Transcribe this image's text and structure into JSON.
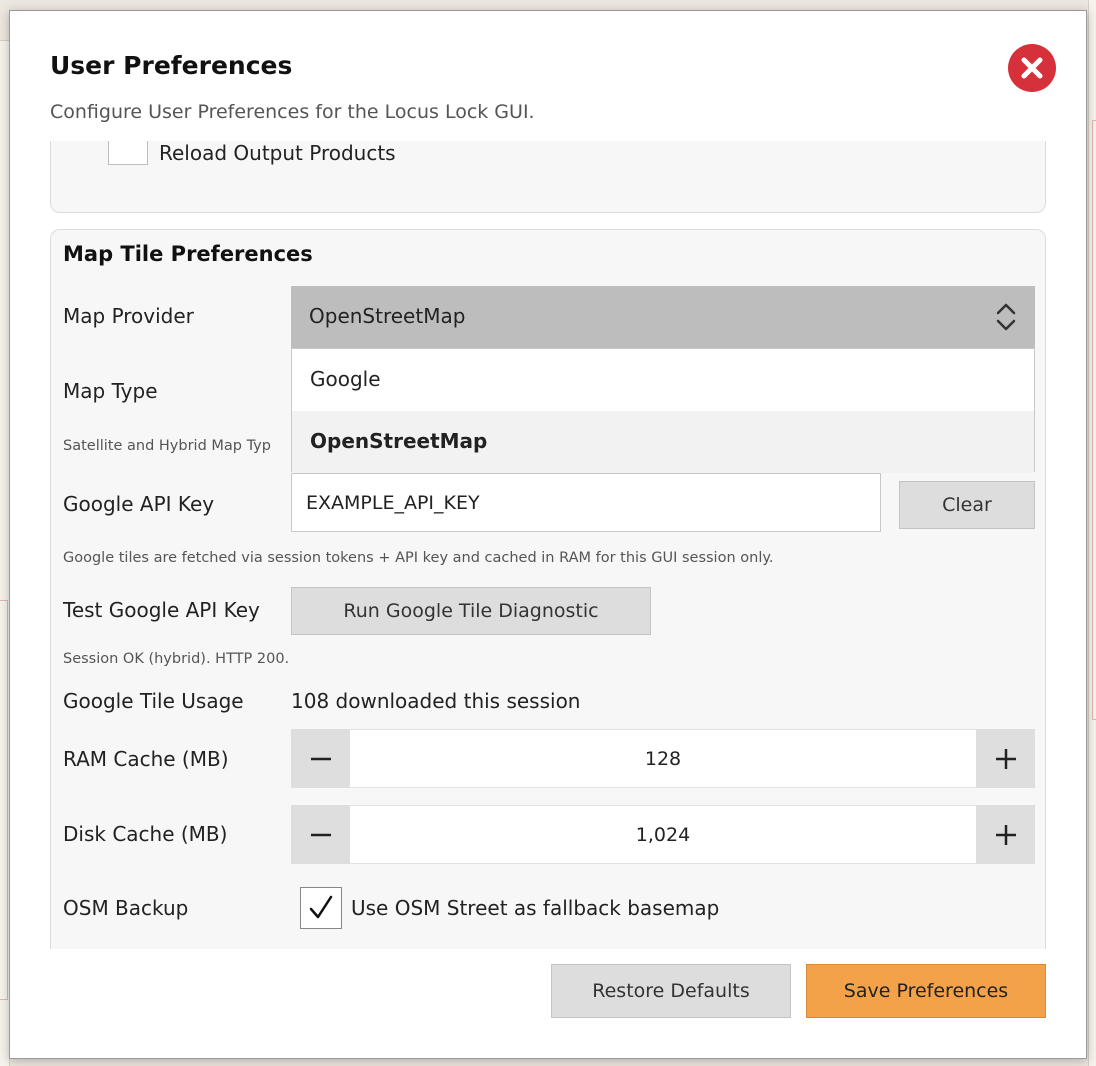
{
  "dialog": {
    "title": "User Preferences",
    "subtitle": "Configure User Preferences for the Locus Lock GUI."
  },
  "general": {
    "reload_label": "Reload Output Products",
    "reload_checked": false
  },
  "map_tiles": {
    "section_title": "Map Tile Preferences",
    "provider_label": "Map Provider",
    "provider_value": "OpenStreetMap",
    "provider_options": [
      "Google",
      "OpenStreetMap"
    ],
    "map_type_label": "Map Type",
    "map_type_hint": "Satellite and Hybrid Map Typ",
    "api_key_label": "Google API Key",
    "api_key_value": "EXAMPLE_API_KEY",
    "clear_label": "Clear",
    "api_hint": "Google tiles are fetched via session tokens + API key and cached in RAM for this GUI session only.",
    "test_label": "Test Google API Key",
    "diagnostic_label": "Run Google Tile Diagnostic",
    "diagnostic_result": "Session OK (hybrid). HTTP 200.",
    "usage_label": "Google Tile Usage",
    "usage_value": "108 downloaded this session",
    "ram_cache_label": "RAM Cache (MB)",
    "ram_cache_value": "128",
    "disk_cache_label": "Disk Cache (MB)",
    "disk_cache_value": "1,024",
    "osm_backup_label": "OSM Backup",
    "osm_backup_checked": true,
    "osm_backup_text": "Use OSM Street as fallback basemap"
  },
  "icons": {
    "close": "close-icon",
    "chevron": "chevron-up-down-icon",
    "minus": "minus-icon",
    "plus": "plus-icon",
    "check": "check-icon"
  },
  "footer": {
    "restore_label": "Restore Defaults",
    "save_label": "Save Preferences"
  },
  "colors": {
    "close_button": "#d6303a",
    "save_button": "#f4a24a",
    "select_background": "#bdbdbd"
  }
}
